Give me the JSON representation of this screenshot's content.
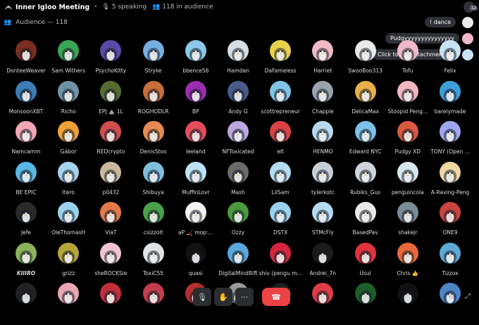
{
  "header": {
    "title": "Inner Igloo Meeting",
    "speaking": "5 speaking",
    "audience": "118 in audience",
    "notification_count": "12"
  },
  "audience_label": "Audience — 118",
  "bubbles": {
    "dance": "dance",
    "message": "Pudgyyyyyyyyyyyyyyy",
    "attachment": "Click to see attachment"
  },
  "colors": {
    "background": "#000000",
    "tile_text": "#dcddde",
    "leave_button": "#ed4245",
    "bubble": "#2f3136"
  },
  "members": [
    [
      {
        "name": "DonteeWeaver",
        "bg": "#7a2e1e"
      },
      {
        "name": "Sam Withers",
        "bg": "#3aa655"
      },
      {
        "name": "PsychoKitty",
        "bg": "#5b4aa6"
      },
      {
        "name": "Stryke",
        "bg": "#77aee0"
      },
      {
        "name": "bbence56",
        "bg": "#8ec8e8"
      },
      {
        "name": "Hamdan",
        "bg": "#d7dde2"
      },
      {
        "name": "DaFameless",
        "bg": "#e8d24a"
      },
      {
        "name": "Harriet",
        "bg": "#f2b8c6"
      },
      {
        "name": "SwooBoo313",
        "bg": "#e9e9e9"
      },
      {
        "name": "Tofu",
        "bg": "#f0b9c9"
      },
      {
        "name": "Felix",
        "bg": "#c7e3f4"
      }
    ],
    [
      {
        "name": "MonsoonXBT",
        "bg": "#3c7cb8"
      },
      {
        "name": "Richo",
        "bg": "#6f93a6"
      },
      {
        "name": "EPJ ⛰️ 1L",
        "bg": "#566b2f"
      },
      {
        "name": "ROGHODLR",
        "bg": "#c86e3a"
      },
      {
        "name": "BP",
        "bg": "#9b2fb0"
      },
      {
        "name": "Andy G",
        "bg": "#4a5a8a"
      },
      {
        "name": "scottrepreneur",
        "bg": "#7fc6e6"
      },
      {
        "name": "Chapple",
        "bg": "#9aa3ad"
      },
      {
        "name": "DelicaMax",
        "bg": "#e7b04a"
      },
      {
        "name": "Stoopid Peng...",
        "bg": "#f3b6c3"
      },
      {
        "name": "barelymade",
        "bg": "#3fa0d9"
      }
    ],
    [
      {
        "name": "Namcamm",
        "bg": "#f3a7b9"
      },
      {
        "name": "Gábor",
        "bg": "#f0a135"
      },
      {
        "name": "REDcrypto",
        "bg": "#cf4e4e"
      },
      {
        "name": "DenisStoo",
        "bg": "#e88a53"
      },
      {
        "name": "leeland",
        "bg": "#e34d5c"
      },
      {
        "name": "NFToxicated",
        "bg": "#bda7e0"
      },
      {
        "name": "elt",
        "bg": "#d94242"
      },
      {
        "name": "HENMO",
        "bg": "#b8d9ec"
      },
      {
        "name": "Edward NYC",
        "bg": "#7ec0e8"
      },
      {
        "name": "Pudgy XD",
        "bg": "#d9593f"
      },
      {
        "name": "TONY (Open ...",
        "bg": "#9ea7ef"
      }
    ],
    [
      {
        "name": "BE EPIC",
        "bg": "#5bb7e6"
      },
      {
        "name": "Itero",
        "bg": "#a5d2ec"
      },
      {
        "name": "p0432",
        "bg": "#c9b99a"
      },
      {
        "name": "Shibuya",
        "bg": "#7fbfdc"
      },
      {
        "name": "MuffinLovr",
        "bg": "#bde3f2"
      },
      {
        "name": "Mash",
        "bg": "#6a6a6a"
      },
      {
        "name": "LilSam",
        "bg": "#b5dcf0"
      },
      {
        "name": "tylerkotc",
        "bg": "#c9ced4"
      },
      {
        "name": "Rubiks_Gus",
        "bg": "#cfd5da"
      },
      {
        "name": "penguincola",
        "bg": "#d8e6ee"
      },
      {
        "name": "A-Raving-Peng",
        "bg": "#eed7a3"
      }
    ],
    [
      {
        "name": "Jefe",
        "bg": "#2a2a2a"
      },
      {
        "name": "OleThomasH",
        "bg": "#9bd3ee"
      },
      {
        "name": "ViaT",
        "bg": "#e37a4a"
      },
      {
        "name": "csizzolt",
        "bg": "#4aa04a"
      },
      {
        "name": "aP 🏒 mop:...",
        "bg": "#f2f2f2"
      },
      {
        "name": "Ozzy",
        "bg": "#4d9a3d"
      },
      {
        "name": "DSTX",
        "bg": "#9ad1ec"
      },
      {
        "name": "STMcFly",
        "bg": "#b3dcf1"
      },
      {
        "name": "BasedPav",
        "bg": "#e9e9e9"
      },
      {
        "name": "shakejr",
        "bg": "#7b8c99"
      },
      {
        "name": "ONE9",
        "bg": "#c9433d"
      }
    ],
    [
      {
        "name": "KIIIRO",
        "bg": "#8bb35a",
        "italic": true
      },
      {
        "name": "grizz",
        "bg": "#b7a53a"
      },
      {
        "name": "sheROCKSie",
        "bg": "#f0c4cf"
      },
      {
        "name": "ToxiC55",
        "bg": "#dfe3e6"
      },
      {
        "name": "quasi",
        "bg": "#111111"
      },
      {
        "name": "DigitalMindRift",
        "bg": "#5aa7dc"
      },
      {
        "name": "shiv (pengu m...",
        "bg": "#d6263e"
      },
      {
        "name": "Andrei_7n",
        "bg": "#1b1b1b"
      },
      {
        "name": "Usul",
        "bg": "#e0333f"
      },
      {
        "name": "Chris 👍",
        "bg": "#e86a3a"
      },
      {
        "name": "Tizzox",
        "bg": "#5da9d6"
      }
    ],
    [
      {
        "name": "",
        "bg": "#222222"
      },
      {
        "name": "",
        "bg": "#e9a7b6"
      },
      {
        "name": "",
        "bg": "#c02f3a"
      },
      {
        "name": "",
        "bg": "#c23d4d"
      },
      {
        "name": "",
        "bg": "#b42f2f"
      },
      {
        "name": "",
        "bg": "#999999"
      },
      {
        "name": "",
        "bg": "#1e1e1e"
      },
      {
        "name": "",
        "bg": "#de3b46"
      },
      {
        "name": "",
        "bg": "#1e5e2a"
      },
      {
        "name": "",
        "bg": "#111111"
      },
      {
        "name": "",
        "bg": "#4d86c8"
      }
    ]
  ],
  "controls": {
    "mute_label": "🎙",
    "hand_label": "✋",
    "more_label": "···",
    "leave_label": "☎"
  }
}
